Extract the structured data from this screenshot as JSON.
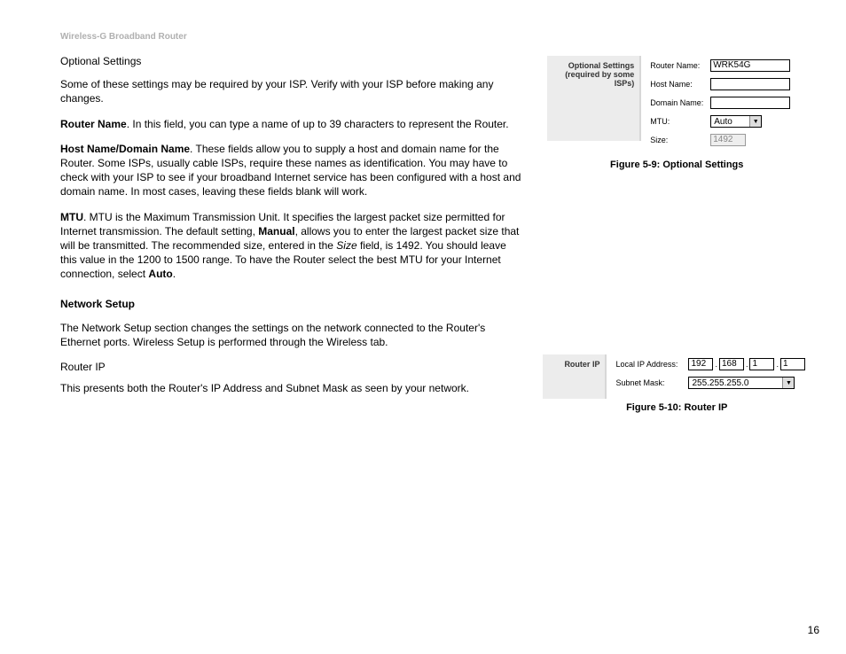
{
  "header": "Wireless-G Broadband Router",
  "left": {
    "optional_title": "Optional Settings",
    "para_intro": "Some of these settings may be required by your ISP. Verify with your ISP before making any changes.",
    "routername_b": "Router Name",
    "routername_t": ". In this field, you can type a name of up to 39 characters to represent the Router.",
    "hostdomain_b": "Host Name/Domain Name",
    "hostdomain_t": ". These fields allow you to supply a host and domain name for the Router. Some ISPs, usually cable ISPs, require these names as identification. You may have to check with your ISP to see if your broadband Internet service has been configured with a host and domain name. In most cases, leaving these fields blank will work.",
    "mtu_b": "MTU",
    "mtu_t1": ". MTU is the Maximum Transmission Unit. It specifies the largest packet size permitted for Internet transmission. The default setting, ",
    "mtu_manual": "Manual",
    "mtu_t2": ", allows you to enter the largest packet size that will be transmitted. The recommended size, entered in the ",
    "mtu_size_it": "Size",
    "mtu_t3": " field, is 1492. You should leave this value in the 1200 to 1500 range. To have the Router select the best MTU for your Internet connection, select ",
    "mtu_auto": "Auto",
    "mtu_t4": ".",
    "network_title": "Network Setup",
    "network_para": "The Network Setup section changes the settings on the network connected to the Router's Ethernet ports. Wireless Setup is performed through the Wireless tab.",
    "routerip_title": "Router IP",
    "routerip_para": "This presents both the Router's IP Address and Subnet Mask as seen by your network."
  },
  "fig59": {
    "box_line1": "Optional Settings",
    "box_line2": "(required by some ISPs)",
    "labels": {
      "router_name": "Router Name:",
      "host_name": "Host Name:",
      "domain_name": "Domain Name:",
      "mtu": "MTU:",
      "size": "Size:"
    },
    "values": {
      "router_name": "WRK54G",
      "host_name": "",
      "domain_name": "",
      "mtu": "Auto",
      "size": "1492"
    },
    "caption": "Figure 5-9: Optional Settings"
  },
  "fig510": {
    "box_label": "Router IP",
    "labels": {
      "local_ip": "Local IP Address:",
      "subnet": "Subnet Mask:"
    },
    "values": {
      "ip1": "192",
      "ip2": "168",
      "ip3": "1",
      "ip4": "1",
      "subnet": "255.255.255.0"
    },
    "caption": "Figure 5-10: Router IP"
  },
  "page_number": "16"
}
